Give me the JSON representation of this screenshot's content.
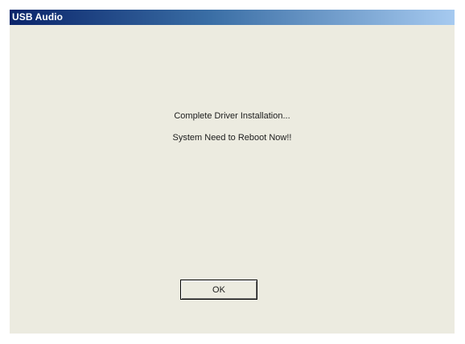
{
  "window": {
    "title": "USB Audio"
  },
  "message": {
    "line1": "Complete Driver Installation...",
    "line2": "System Need to Reboot Now!!"
  },
  "buttons": {
    "ok_label": "OK"
  },
  "colors": {
    "titlebar_start": "#0a246a",
    "titlebar_end": "#a6caf0",
    "dialog_background": "#ecebe0",
    "title_text": "#ffffff"
  }
}
